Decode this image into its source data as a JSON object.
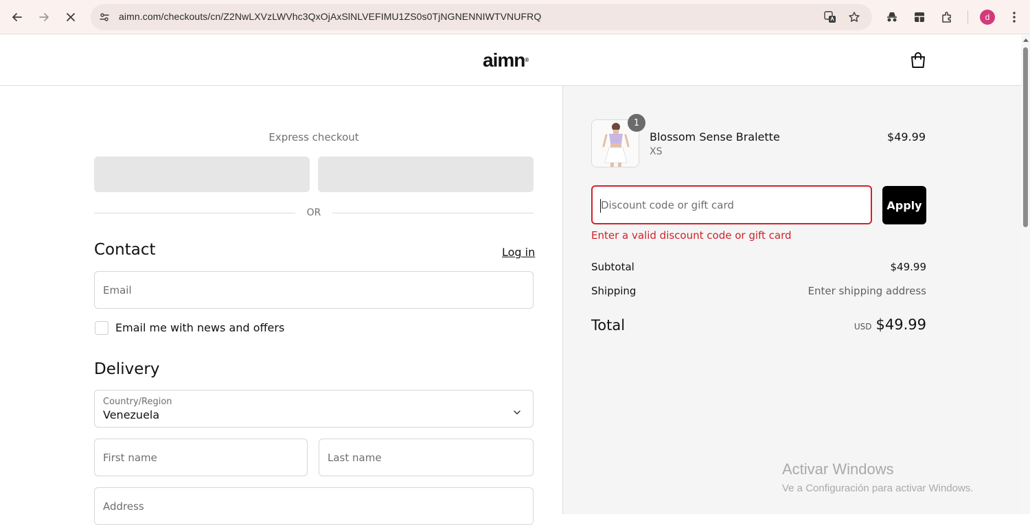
{
  "browser": {
    "url": "aimn.com/checkouts/cn/Z2NwLXVzLWVhc3QxOjAxSlNLVEFIMU1ZS0s0TjNGNENNIWTVNUFRQ",
    "profile_initial": "d",
    "icons": [
      "back-arrow-icon",
      "forward-arrow-icon",
      "stop-loading-icon",
      "site-info-icon",
      "translate-icon",
      "bookmark-star-icon",
      "incognito-icon",
      "split-view-icon",
      "extensions-icon",
      "more-menu-icon"
    ]
  },
  "header": {
    "logo_text": "aimn",
    "logo_mark": "®"
  },
  "express": {
    "title": "Express checkout",
    "or_label": "OR"
  },
  "contact": {
    "title": "Contact",
    "login_label": "Log in",
    "email_placeholder": "Email",
    "newsletter_label": "Email me with news and offers"
  },
  "delivery": {
    "title": "Delivery",
    "country_label": "Country/Region",
    "country_value": "Venezuela",
    "first_name_placeholder": "First name",
    "last_name_placeholder": "Last name",
    "address_placeholder": "Address"
  },
  "summary": {
    "item": {
      "quantity": "1",
      "name": "Blossom Sense Bralette",
      "variant": "XS",
      "price": "$49.99"
    },
    "discount_placeholder": "Discount code or gift card",
    "apply_label": "Apply",
    "discount_error": "Enter a valid discount code or gift card",
    "subtotal_label": "Subtotal",
    "subtotal_value": "$49.99",
    "shipping_label": "Shipping",
    "shipping_value": "Enter shipping address",
    "total_label": "Total",
    "total_currency": "USD",
    "total_value": "$49.99"
  },
  "watermark": {
    "line1": "Activar Windows",
    "line2": "Ve a Configuración para activar Windows."
  },
  "colors": {
    "error": "#d3202a",
    "apply_button": "#000000",
    "summary_background": "#f5f5f5",
    "chrome_background": "#fbf1ee"
  }
}
